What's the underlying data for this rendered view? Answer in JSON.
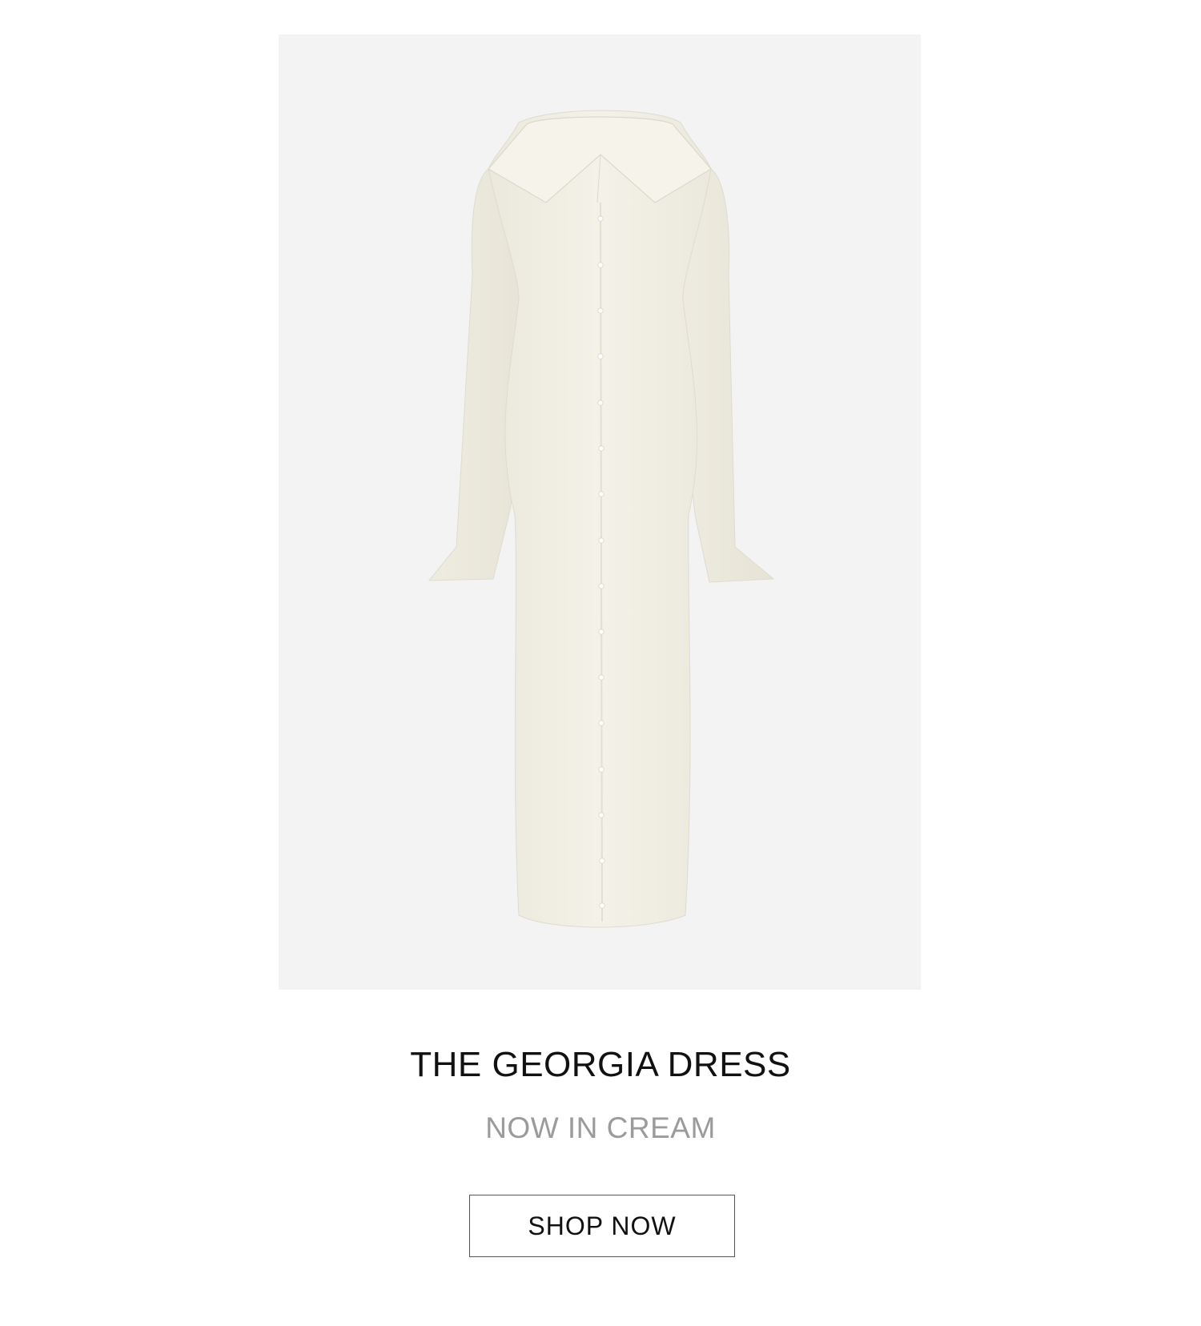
{
  "product": {
    "image_alt": "Cream button-front long-sleeve dress",
    "title": "THE GEORGIA DRESS",
    "subtitle": "NOW IN CREAM",
    "cta_label": "SHOP NOW"
  },
  "colors": {
    "image_background": "#f3f3f3",
    "garment": "#f2f0e6",
    "title": "#111111",
    "subtitle": "#9b9b9b",
    "button_border": "#555555"
  }
}
